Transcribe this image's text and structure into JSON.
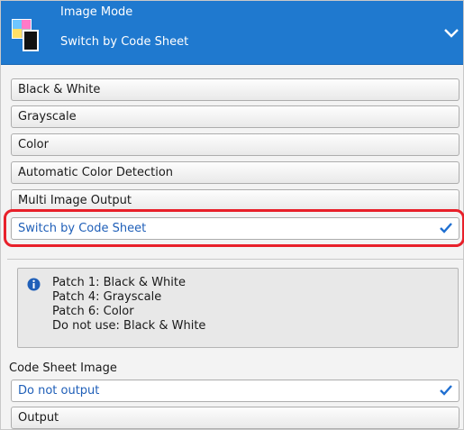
{
  "header": {
    "title": "Image Mode",
    "subtitle": "Switch by Code Sheet",
    "background_color": "#1f79cf",
    "icon": "image-mode-icon",
    "expand_icon": "chevron-down-icon"
  },
  "options": [
    {
      "label": "Black & White",
      "selected": false
    },
    {
      "label": "Grayscale",
      "selected": false
    },
    {
      "label": "Color",
      "selected": false
    },
    {
      "label": "Automatic Color Detection",
      "selected": false
    },
    {
      "label": "Multi Image Output",
      "selected": false
    },
    {
      "label": "Switch by Code Sheet",
      "selected": true
    }
  ],
  "highlight_color": "#e8202a",
  "info": {
    "icon": "info-icon",
    "lines": [
      "Patch 1: Black & White",
      "Patch 4: Grayscale",
      "Patch 6: Color",
      "Do not use: Black & White"
    ]
  },
  "code_sheet_image": {
    "label": "Code Sheet Image",
    "options": [
      {
        "label": "Do not output",
        "selected": true
      },
      {
        "label": "Output",
        "selected": false
      }
    ]
  },
  "selected_text_color": "#1f5fb8",
  "check_color": "#1f6fd1"
}
